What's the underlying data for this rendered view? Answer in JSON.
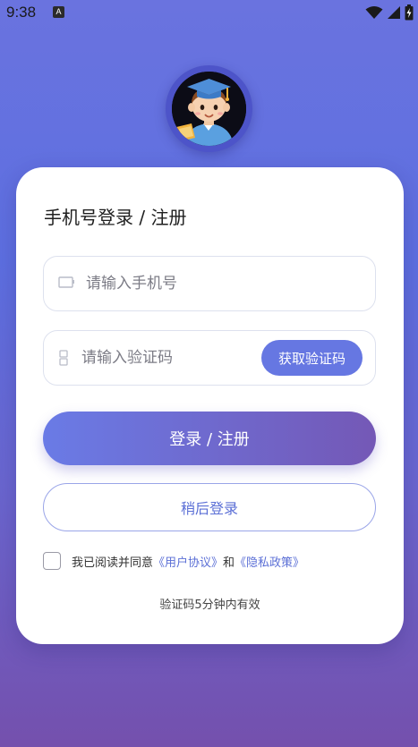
{
  "status_bar": {
    "time": "9:38",
    "notification_icon": "A"
  },
  "login": {
    "title": "手机号登录 / 注册",
    "phone_placeholder": "请输入手机号",
    "code_placeholder": "请输入验证码",
    "get_code_label": "获取验证码",
    "login_label": "登录 / 注册",
    "later_label": "稍后登录",
    "agree_prefix": "我已阅读并同意",
    "user_agreement": "《用户协议》",
    "and": "和",
    "privacy_policy": "《隐私政策》",
    "validity_note": "验证码5分钟内有效"
  },
  "colors": {
    "accent": "#6677e2",
    "gradient_start": "#6a7be6",
    "gradient_end": "#7458b6",
    "link": "#5b6fd6"
  },
  "icons": [
    "wifi-icon",
    "signal-icon",
    "battery-icon",
    "phone-icon",
    "code-icon",
    "avatar-student-icon"
  ]
}
